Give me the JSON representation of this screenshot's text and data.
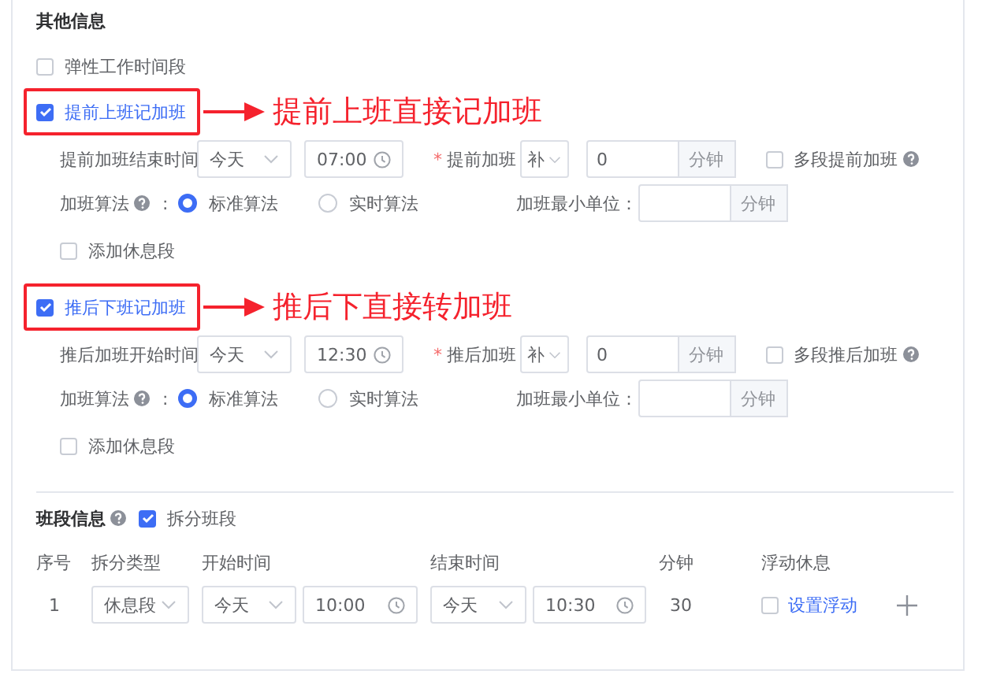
{
  "section_title": "其他信息",
  "flexible": {
    "label": "弹性工作时间段",
    "checked": false
  },
  "overtime": [
    {
      "label": "提前上班记加班",
      "checked": true,
      "annotation": "提前上班直接记加班",
      "time_label": "提前加班结束时间",
      "day": "今天",
      "time": "07:00",
      "required_mark": "*",
      "amount_label": "提前加班",
      "comp": "补",
      "amount": "0",
      "unit": "分钟",
      "multi": {
        "label": "多段提前加班",
        "checked": false
      },
      "method_label": "加班算法",
      "method_colon": ":",
      "methods": [
        {
          "label": "标准算法",
          "selected": true
        },
        {
          "label": "实时算法",
          "selected": false
        }
      ],
      "min_unit_label": "加班最小单位：",
      "min_unit": "分钟",
      "rest": {
        "label": "添加休息段",
        "checked": false
      }
    },
    {
      "label": "推后下班记加班",
      "checked": true,
      "annotation": "推后下直接转加班",
      "time_label": "推后加班开始时间",
      "day": "今天",
      "time": "12:30",
      "required_mark": "*",
      "amount_label": "推后加班",
      "comp": "补",
      "amount": "0",
      "unit": "分钟",
      "multi": {
        "label": "多段推后加班",
        "checked": false
      },
      "method_label": "加班算法",
      "method_colon": ":",
      "methods": [
        {
          "label": "标准算法",
          "selected": true
        },
        {
          "label": "实时算法",
          "selected": false
        }
      ],
      "min_unit_label": "加班最小单位：",
      "min_unit": "分钟",
      "rest": {
        "label": "添加休息段",
        "checked": false
      }
    }
  ],
  "shift": {
    "title": "班段信息",
    "split": {
      "label": "拆分班段",
      "checked": true
    },
    "columns": [
      "序号",
      "拆分类型",
      "开始时间",
      "结束时间",
      "分钟",
      "浮动休息"
    ],
    "rows": [
      {
        "index": "1",
        "type": "休息段",
        "start_day": "今天",
        "start_time": "10:00",
        "end_day": "今天",
        "end_time": "10:30",
        "minutes": "30",
        "float": {
          "label": "设置浮动",
          "checked": false
        }
      }
    ]
  }
}
